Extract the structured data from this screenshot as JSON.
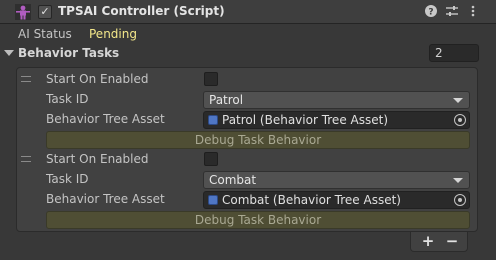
{
  "header": {
    "title": "TPSAI Controller (Script)",
    "enabled_mark": "✓",
    "icons": [
      "component-icon",
      "help-icon",
      "preset-icon",
      "more-icon"
    ]
  },
  "ai_status": {
    "label": "AI Status",
    "value": "Pending"
  },
  "behavior_tasks": {
    "label": "Behavior Tasks",
    "count": "2",
    "items": [
      {
        "start_label": "Start On Enabled",
        "start_checked": false,
        "task_label": "Task ID",
        "task_value": "Patrol",
        "tree_label": "Behavior Tree Asset",
        "tree_value": "Patrol (Behavior Tree Asset)",
        "debug_label": "Debug Task Behavior"
      },
      {
        "start_label": "Start On Enabled",
        "start_checked": false,
        "task_label": "Task ID",
        "task_value": "Combat",
        "tree_label": "Behavior Tree Asset",
        "tree_value": "Combat (Behavior Tree Asset)",
        "debug_label": "Debug Task Behavior"
      }
    ],
    "add_label": "+",
    "remove_label": "−"
  },
  "colors": {
    "status_value": "#f3e78a",
    "debug_button": "#4f4e34",
    "asset_icon": "#4f76c4"
  }
}
